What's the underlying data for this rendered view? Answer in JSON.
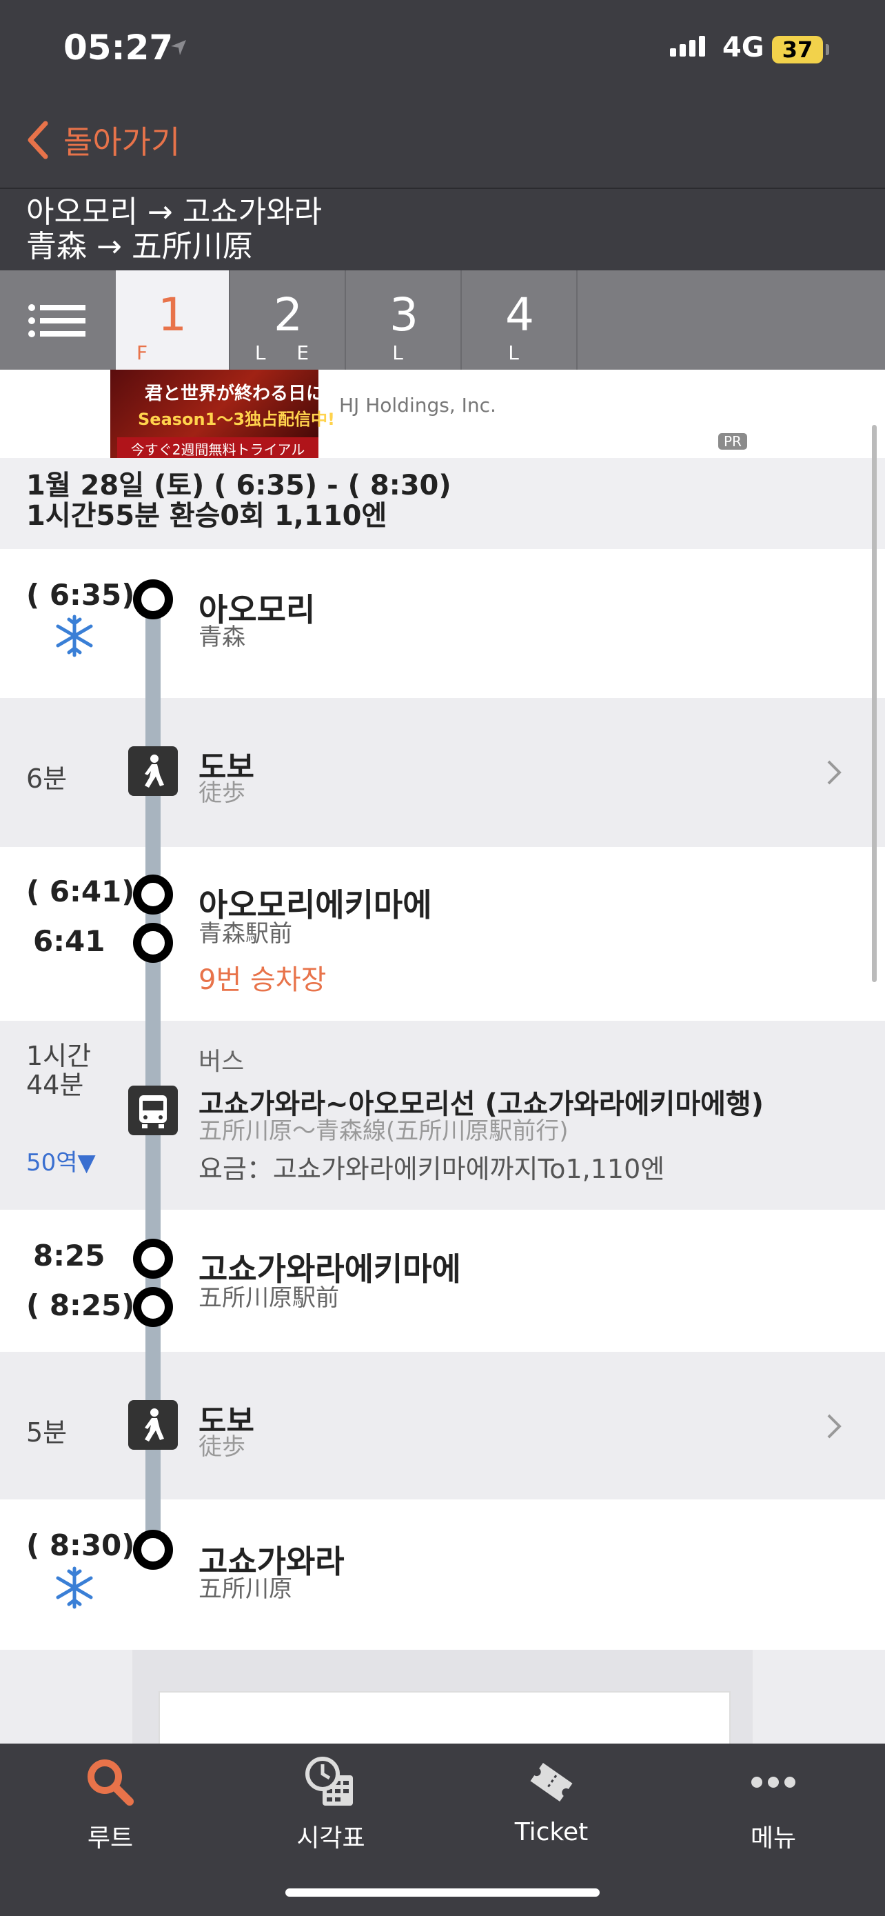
{
  "status_bar": {
    "time": "05:27",
    "network": "4G",
    "battery": "37"
  },
  "nav": {
    "back_label": "돌아가기"
  },
  "route": {
    "title_ko": "아오모리 → 고쇼가와라",
    "title_ja": "青森 → 五所川原"
  },
  "tabs": [
    {
      "label": "1",
      "sub": "F",
      "active": true
    },
    {
      "label": "2",
      "sub": "L E",
      "active": false
    },
    {
      "label": "3",
      "sub": "L",
      "active": false
    },
    {
      "label": "4",
      "sub": "L",
      "active": false
    }
  ],
  "ad": {
    "image_text_1": "君と世界が終わる日に",
    "image_text_2": "Season1〜3独占配信中!",
    "image_text_3": "今すぐ2週間無料トライアル",
    "sponsor": "HJ Holdings, Inc.",
    "badge": "PR"
  },
  "summary": {
    "line1": "1월 28일 (토) ( 6:35) - ( 8:30)",
    "line2": "1시간55분 환승0회 1,110엔"
  },
  "itinerary": {
    "origin": {
      "time": "( 6:35)",
      "name": "아오모리",
      "name_ja": "青森"
    },
    "walk1": {
      "duration": "6분",
      "title": "도보",
      "sub": "徒歩"
    },
    "stop1": {
      "arr": "( 6:41)",
      "dep": "6:41",
      "name": "아오모리에키마에",
      "name_ja": "青森駅前",
      "platform": "9번 승차장"
    },
    "bus": {
      "duration": "1시간\n44분",
      "stops": "50역▼",
      "type": "버스",
      "line": "고쇼가와라~아오모리선 (고쇼가와라에키마에행)",
      "line_ja": "五所川原〜青森線(五所川原駅前行)",
      "fare": "요금：고쇼가와라에키마에까지To1,110엔"
    },
    "stop2": {
      "arr": "8:25",
      "dep": "( 8:25)",
      "name": "고쇼가와라에키마에",
      "name_ja": "五所川原駅前"
    },
    "walk2": {
      "duration": "5분",
      "title": "도보",
      "sub": "徒歩"
    },
    "destination": {
      "time": "( 8:30)",
      "name": "고쇼가와라",
      "name_ja": "五所川原"
    }
  },
  "bottom_nav": [
    {
      "label": "루트",
      "icon": "search-icon",
      "active": true
    },
    {
      "label": "시각표",
      "icon": "timetable-icon",
      "active": false
    },
    {
      "label": "Ticket",
      "icon": "ticket-icon",
      "active": false
    },
    {
      "label": "메뉴",
      "icon": "more-icon",
      "active": false
    }
  ],
  "colors": {
    "accent": "#e8734a",
    "bar": "#3d3d42",
    "blue": "#3a6fd0"
  }
}
